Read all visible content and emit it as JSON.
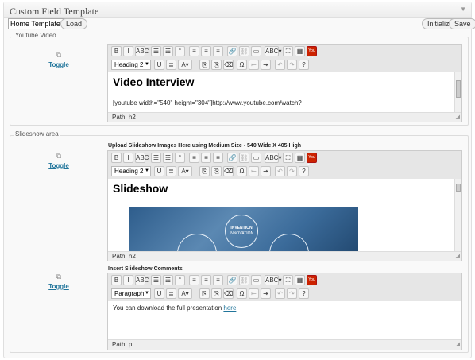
{
  "panel": {
    "title": "Custom Field Template",
    "collapse": "▼"
  },
  "controls": {
    "template_select": "Home Template",
    "load": "Load",
    "initialize": "Initialize",
    "save": "Save"
  },
  "toggle_label": "Toggle",
  "toolbar": {
    "bold": "B",
    "italic": "I",
    "strike": "ABC",
    "ul": "☰",
    "ol": "☷",
    "quote": "“",
    "align_left": "≡",
    "align_center": "≡",
    "align_right": "≡",
    "link": "🔗",
    "unlink": "⛓",
    "more": "▭",
    "spell": "ABC▾",
    "fullscreen": "⛶",
    "kitchen": "▦",
    "youtube": "You Tube",
    "underline": "U",
    "justify": "≣",
    "color": "A▾",
    "paste_text": "⎘",
    "paste_word": "⎘",
    "remove_fmt": "⌫",
    "charmap": "Ω",
    "outdent": "⇤",
    "indent": "⇥",
    "undo": "↶",
    "redo": "↷",
    "help": "?"
  },
  "youtube_box": {
    "legend": "Youtube Video",
    "format": "Heading 2",
    "heading": "Video Interview",
    "text": "[youtube width=\"540\" height=\"304\"]http://www.youtube.com/watch?",
    "path": "Path: h2"
  },
  "slideshow_box": {
    "legend": "Slideshow area",
    "label": "Upload Slideshow Images Here using Medium Size - 540 Wide X 405 High",
    "format": "Heading 2",
    "heading": "Slideshow",
    "diagram_title": "INVENTION",
    "diagram_sub": "INNOVATION",
    "path": "Path: h2"
  },
  "comments": {
    "label": "Insert Slideshow Comments",
    "format": "Paragraph",
    "text": "You can download the full presentation ",
    "link": "here",
    "period": ".",
    "path": "Path: p"
  }
}
